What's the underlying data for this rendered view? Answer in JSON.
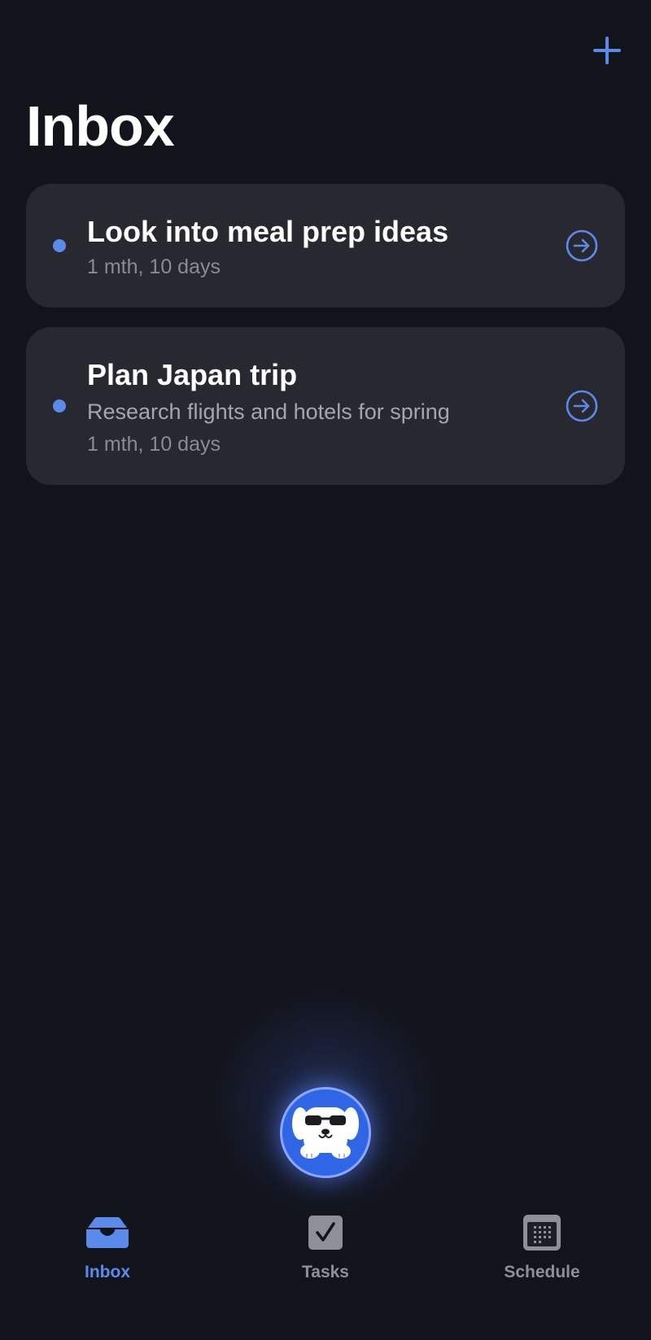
{
  "header": {
    "title": "Inbox",
    "add_icon": "plus-icon"
  },
  "inbox": {
    "items": [
      {
        "title": "Look into meal prep ideas",
        "description": "",
        "age": "1 mth, 10 days",
        "unread": true,
        "action_icon": "arrow-right-circle-icon"
      },
      {
        "title": "Plan Japan trip",
        "description": "Research flights and hotels for spring",
        "age": "1 mth, 10 days",
        "unread": true,
        "action_icon": "arrow-right-circle-icon"
      }
    ]
  },
  "assistant": {
    "icon": "dog-with-sunglasses-avatar"
  },
  "tabs": [
    {
      "label": "Inbox",
      "icon": "inbox-tray-icon",
      "active": true
    },
    {
      "label": "Tasks",
      "icon": "checkbox-icon",
      "active": false
    },
    {
      "label": "Schedule",
      "icon": "calendar-icon",
      "active": false
    }
  ],
  "colors": {
    "background": "#12141b",
    "card": "#272830",
    "accent": "#5b8bea",
    "text_primary": "#ffffff",
    "text_secondary": "#a4a6ad",
    "tab_inactive": "#8e9097"
  }
}
